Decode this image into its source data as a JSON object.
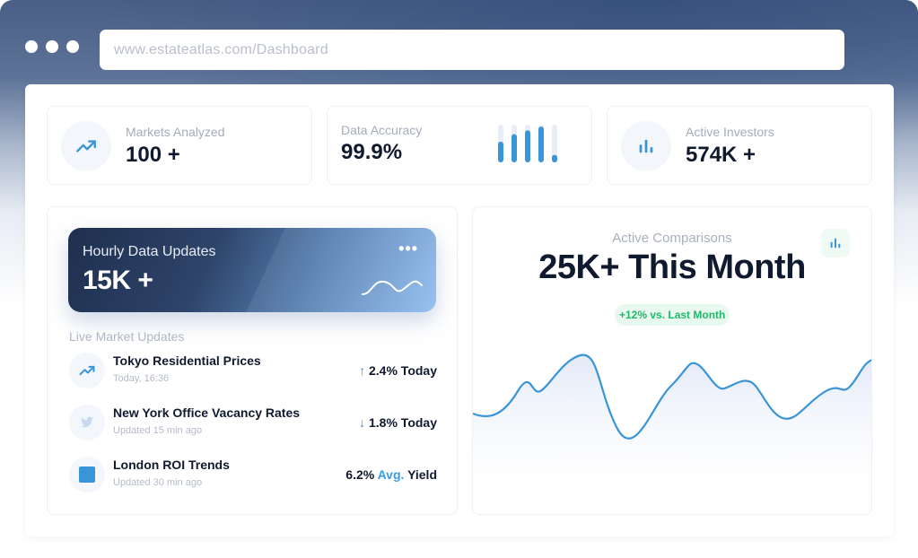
{
  "browser": {
    "url": "www.estateatlas.com/Dashboard"
  },
  "stats": [
    {
      "label": "Markets Analyzed",
      "value": "100 +",
      "icon": "trend-up-icon"
    },
    {
      "label": "Data Accuracy",
      "value": "99.9%",
      "mini_bars_fill": [
        0.55,
        0.75,
        0.85,
        0.95,
        0.2
      ]
    },
    {
      "label": "Active Investors",
      "value": "574K +",
      "icon": "bar-chart-icon"
    }
  ],
  "hero": {
    "label": "Hourly Data Updates",
    "value": "15K +",
    "menu": "•••"
  },
  "live_updates": {
    "title": "Live Market Updates",
    "items": [
      {
        "name": "Tokyo Residential Prices",
        "sub": "Today, 16:36",
        "arrow": "↑",
        "value": "2.4% Today",
        "icon": "trend-up-icon"
      },
      {
        "name": "New York Office Vacancy Rates",
        "sub": "Updated 15 min ago",
        "arrow": "↓",
        "value": "1.8% Today",
        "icon": "bird-icon"
      },
      {
        "name": "London ROI Trends",
        "sub": "Updated 30 min ago",
        "value_pre": "6.2%",
        "value_accent": "Avg.",
        "value_post": "Yield",
        "icon": "square-icon"
      }
    ]
  },
  "comparisons": {
    "label": "Active Comparisons",
    "value": "25K+ This Month",
    "badge": "+12% vs. Last Month",
    "icon": "bar-chart-icon",
    "accent": "#3a95d8"
  }
}
